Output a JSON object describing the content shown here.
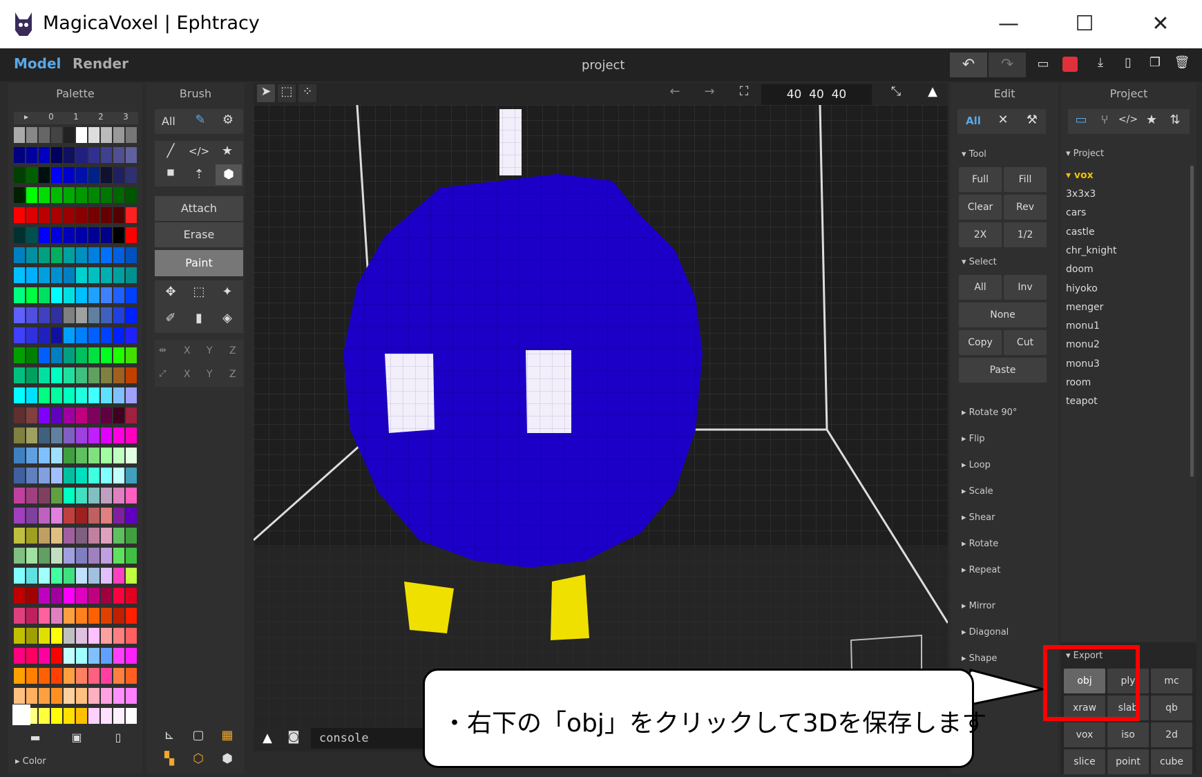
{
  "window": {
    "title": "MagicaVoxel | Ephtracy",
    "minimize": "—",
    "maximize": "☐",
    "close": "✕"
  },
  "tabs": {
    "model": "Model",
    "render": "Render"
  },
  "project_title": "project",
  "palette": {
    "title": "Palette",
    "columns": [
      "▸",
      "0",
      "1",
      "2",
      "3"
    ],
    "color_section": "▸ Color"
  },
  "brush": {
    "title": "Brush",
    "all": "All",
    "modes": [
      "Attach",
      "Erase",
      "Paint"
    ],
    "axis_rows": [
      [
        "X",
        "Y",
        "Z"
      ],
      [
        "X",
        "Y",
        "Z"
      ]
    ]
  },
  "viewport": {
    "dims": "40  40  40",
    "console_placeholder": "console"
  },
  "edit": {
    "title": "Edit",
    "all": "All",
    "tool_section": "▾ Tool",
    "tool_buttons": [
      [
        "Full",
        "Fill"
      ],
      [
        "Clear",
        "Rev"
      ],
      [
        "2X",
        "1/2"
      ]
    ],
    "select_section": "▾ Select",
    "select_buttons": [
      [
        "All",
        "Inv"
      ]
    ],
    "none": "None",
    "copy": "Copy",
    "cut": "Cut",
    "paste": "Paste",
    "ops": [
      "▸ Rotate 90°",
      "▸ Flip",
      "▸ Loop",
      "▸ Scale",
      "▸ Shear",
      "▸ Rotate",
      "▸ Repeat",
      "▸ Mirror",
      "▸ Diagonal",
      "▸ Shape"
    ]
  },
  "project": {
    "title": "Project",
    "section": "▾ Project",
    "folder": "▾ vox",
    "items": [
      "3x3x3",
      "cars",
      "castle",
      "chr_knight",
      "doom",
      "hiyoko",
      "menger",
      "monu1",
      "monu2",
      "monu3",
      "room",
      "teapot"
    ],
    "export_section": "▾ Export",
    "export_buttons": [
      [
        "obj",
        "ply",
        "mc"
      ],
      [
        "xraw",
        "slab",
        "qb"
      ],
      [
        "vox",
        "iso",
        "2d"
      ],
      [
        "slice",
        "point",
        "cube"
      ]
    ]
  },
  "callout": {
    "text": "・右下の「obj」をクリックして3Dを保存します"
  },
  "colors": {
    "accent": "#5aa9e6",
    "voxel": "#1c00c8",
    "feet": "#f0e000",
    "highlight": "#ff0000"
  }
}
